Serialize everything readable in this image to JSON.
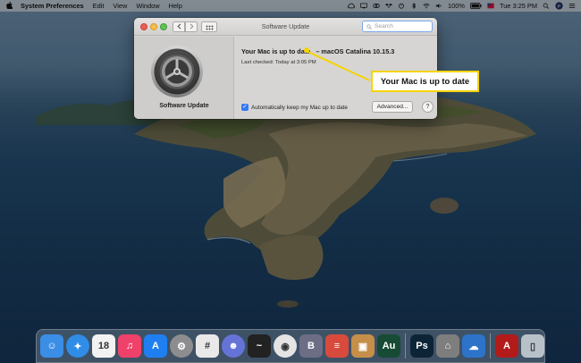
{
  "menubar": {
    "apple": "",
    "app_name": "System Preferences",
    "menus": [
      "Edit",
      "View",
      "Window",
      "Help"
    ],
    "battery": "100%",
    "clock": "Tue 3:25 PM"
  },
  "window": {
    "title": "Software Update",
    "search_placeholder": "Search",
    "pane_name": "Software Update",
    "status": "Your Mac is up to date",
    "version": "– macOS Catalina 10.15.3",
    "last_checked": "Last checked: Today at 3:05 PM",
    "auto_update_label": "Automatically keep my Mac up to date",
    "auto_update_checked": true,
    "advanced_label": "Advanced...",
    "help_label": "?"
  },
  "callout": {
    "text": "Your Mac is up to date",
    "color": "#f5d400"
  },
  "dock": {
    "apps": [
      {
        "name": "finder-icon",
        "glyph": "☺",
        "color": "#3a8ee6"
      },
      {
        "name": "safari-icon",
        "glyph": "✦",
        "color": "#2f8de8"
      },
      {
        "name": "calendar-icon",
        "glyph": "18",
        "color": "#f2f2f2"
      },
      {
        "name": "music-icon",
        "glyph": "♫",
        "color": "#f0416a"
      },
      {
        "name": "app-store-icon",
        "glyph": "A",
        "color": "#1f7ff0"
      },
      {
        "name": "system-preferences-icon",
        "glyph": "⚙",
        "color": "#8d8d8f"
      },
      {
        "name": "slack-icon",
        "glyph": "#",
        "color": "#e9e9e9"
      },
      {
        "name": "discord-icon",
        "glyph": "☻",
        "color": "#6673d6"
      },
      {
        "name": "activity-monitor-icon",
        "glyph": "~",
        "color": "#222"
      },
      {
        "name": "chrome-icon",
        "glyph": "◉",
        "color": "#e4e4e4"
      },
      {
        "name": "bbedit-icon",
        "glyph": "B",
        "color": "#6d6d86"
      },
      {
        "name": "todoist-icon",
        "glyph": "≡",
        "color": "#d84a3c"
      },
      {
        "name": "archive-icon",
        "glyph": "▣",
        "color": "#c58f4a"
      },
      {
        "name": "audition-icon",
        "glyph": "Au",
        "color": "#174b35"
      },
      {
        "name": "photoshop-icon",
        "glyph": "Ps",
        "color": "#0d2437"
      },
      {
        "name": "automator-icon",
        "glyph": "⌂",
        "color": "#7e7e7e"
      },
      {
        "name": "onedrive-icon",
        "glyph": "☁",
        "color": "#2c73c9"
      },
      {
        "name": "acrobat-icon",
        "glyph": "A",
        "color": "#b31a1a"
      },
      {
        "name": "trash-icon",
        "glyph": "▯",
        "color": "#b9c1c8"
      }
    ]
  }
}
